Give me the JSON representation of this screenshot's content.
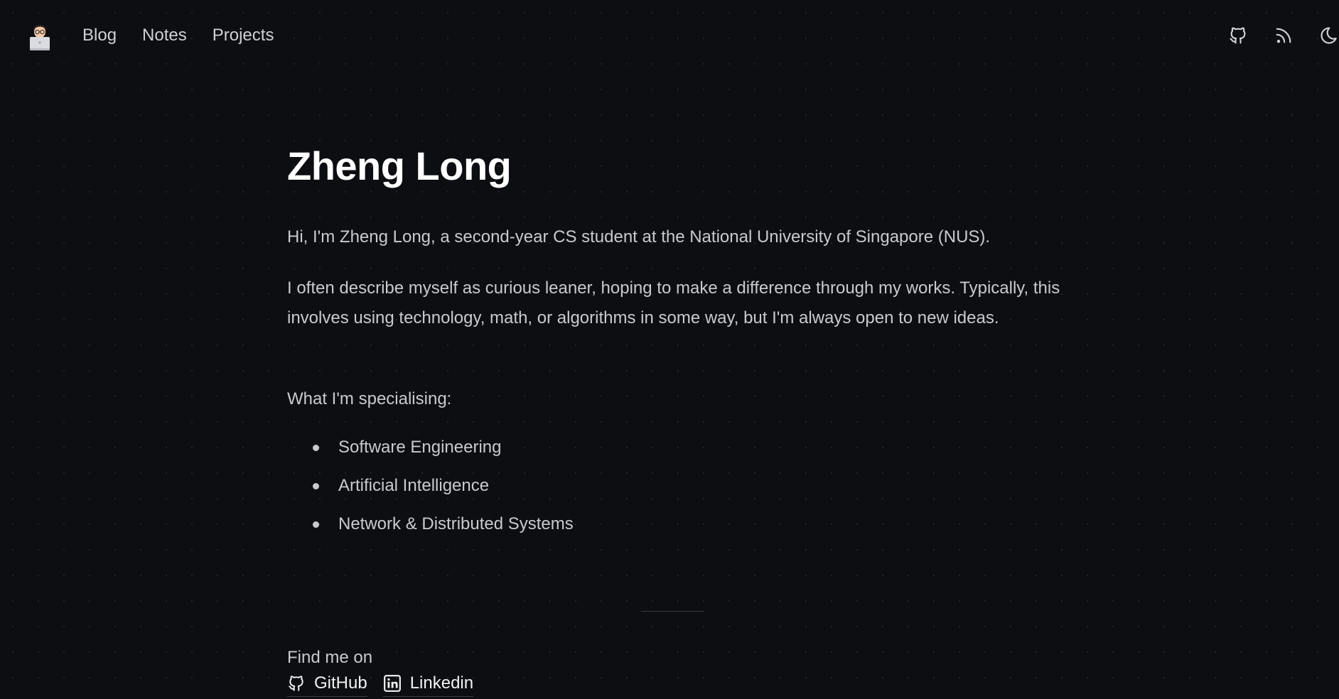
{
  "header": {
    "logo_icon": "memoji-avatar-icon",
    "nav": [
      {
        "label": "Blog"
      },
      {
        "label": "Notes"
      },
      {
        "label": "Projects"
      }
    ],
    "icons": [
      "github-icon",
      "rss-icon",
      "moon-icon"
    ]
  },
  "main": {
    "title": "Zheng Long",
    "intro": "Hi, I'm Zheng Long, a second-year CS student at the National University of Singapore (NUS).",
    "description": "I often describe myself as curious leaner, hoping to make a difference through my works. Typically, this involves using technology, math, or algorithms in some way, but I'm always open to new ideas.",
    "specialising_heading": "What I'm specialising:",
    "specialisations": [
      "Software Engineering",
      "Artificial Intelligence",
      "Network & Distributed Systems"
    ],
    "find_me": "Find me on",
    "socials": [
      {
        "label": "GitHub",
        "icon": "github-icon"
      },
      {
        "label": "Linkedin",
        "icon": "linkedin-icon"
      }
    ]
  },
  "colors": {
    "background": "#0d0e12",
    "text": "#c9cad0",
    "heading": "#ffffff"
  }
}
